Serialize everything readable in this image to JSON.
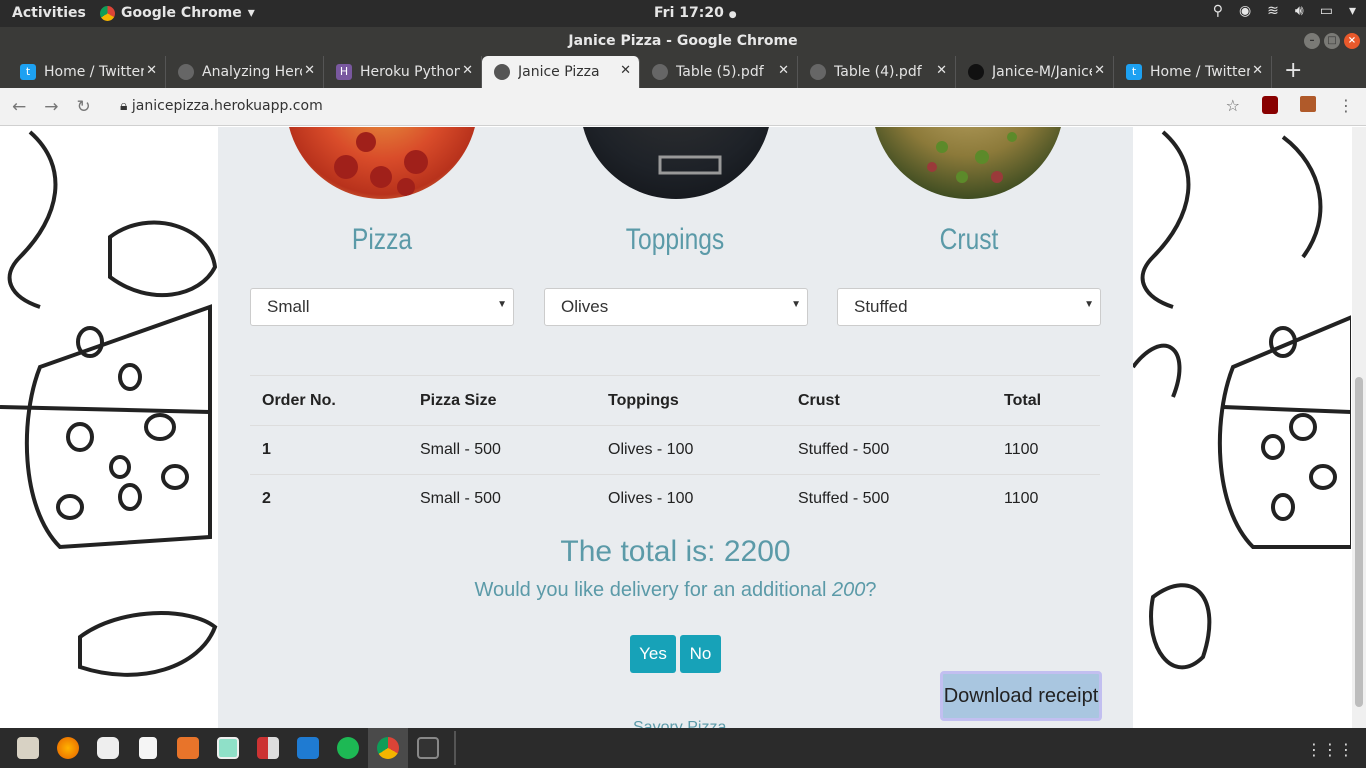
{
  "system_bar": {
    "activities": "Activities",
    "app_name": "Google Chrome",
    "clock": "Fri 17:20",
    "clock_dot": "●"
  },
  "window": {
    "title": "Janice Pizza - Google Chrome"
  },
  "tabs": [
    {
      "label": "Home / Twitter",
      "icon": "twitter-icon",
      "color": "#1da1f2"
    },
    {
      "label": "Analyzing Heroku",
      "icon": "globe-icon",
      "color": "#777777"
    },
    {
      "label": "Heroku Python",
      "icon": "heroku-icon",
      "color": "#79589f"
    },
    {
      "label": "Janice Pizza",
      "icon": "globe-icon",
      "color": "#555555",
      "active": true
    },
    {
      "label": "Table (5).pdf",
      "icon": "globe-icon",
      "color": "#777777"
    },
    {
      "label": "Table (4).pdf",
      "icon": "globe-icon",
      "color": "#777777"
    },
    {
      "label": "Janice-M/Janice",
      "icon": "github-icon",
      "color": "#222222"
    },
    {
      "label": "Home / Twitter",
      "icon": "twitter-icon",
      "color": "#1da1f2"
    }
  ],
  "toolbar": {
    "url": "janicepizza.herokuapp.com"
  },
  "page": {
    "sections": [
      {
        "title": "Pizza",
        "selected": "Small"
      },
      {
        "title": "Toppings",
        "selected": "Olives"
      },
      {
        "title": "Crust",
        "selected": "Stuffed"
      }
    ],
    "table": {
      "headers": [
        "Order No.",
        "Pizza Size",
        "Toppings",
        "Crust",
        "Total"
      ],
      "rows": [
        [
          "1",
          "Small - 500",
          "Olives - 100",
          "Stuffed - 500",
          "1100"
        ],
        [
          "2",
          "Small - 500",
          "Olives - 100",
          "Stuffed - 500",
          "1100"
        ]
      ]
    },
    "total_text": "The total is: 2200",
    "delivery_prefix": "Would you like delivery for an additional ",
    "delivery_amount": "200",
    "delivery_suffix": "?",
    "yes_label": "Yes",
    "no_label": "No",
    "download_label": "Download receipt",
    "footer_peek": "Savory Pizza"
  },
  "colors": {
    "accent": "#5b9aa8",
    "button": "#17a2b8",
    "content_bg": "#e9ecef"
  },
  "taskbar": {
    "apps": [
      "files-icon",
      "firefox-icon",
      "camera-icon",
      "document-icon",
      "package-icon",
      "screenshot-icon",
      "media-icon",
      "vscode-icon",
      "spotify-icon",
      "chrome-icon",
      "terminal-icon"
    ]
  }
}
